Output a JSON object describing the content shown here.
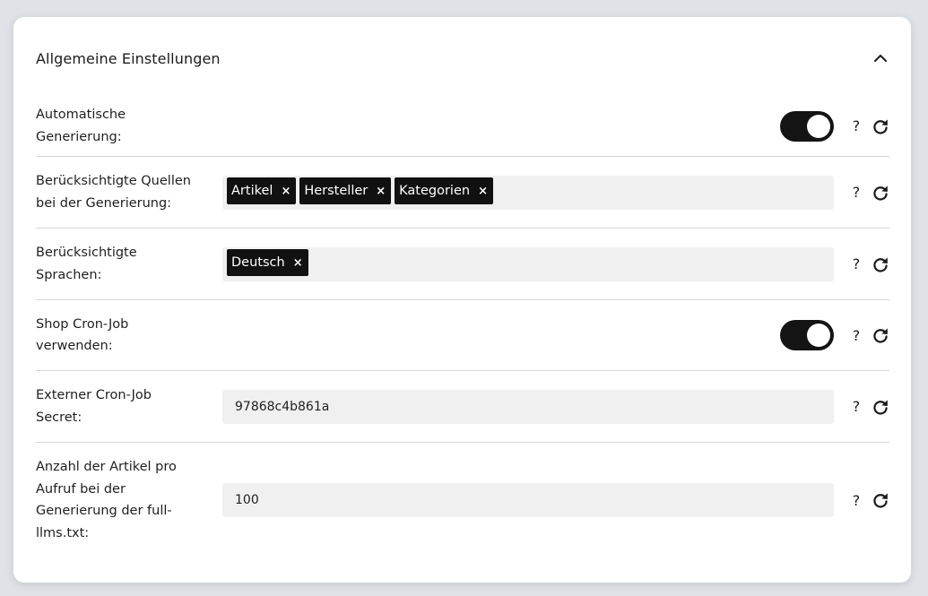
{
  "panel": {
    "title": "Allgemeine Einstellungen",
    "collapse_icon": "chevron-up-icon"
  },
  "settings": [
    {
      "label": "Automatische\nGenerierung:",
      "type": "toggle",
      "enabled": true
    },
    {
      "label": "Berücksichtigte Quellen\nbei der Generierung:",
      "type": "tags",
      "tags": [
        "Artikel",
        "Hersteller",
        "Kategorien"
      ]
    },
    {
      "label": "Berücksichtigte\nSprachen:",
      "type": "tags",
      "tags": [
        "Deutsch"
      ]
    },
    {
      "label": "Shop Cron-Job\nverwenden:",
      "type": "toggle",
      "enabled": true
    },
    {
      "label": "Externer Cron-Job\nSecret:",
      "type": "text",
      "value": "97868c4b861a"
    },
    {
      "label": "Anzahl der Artikel pro\nAufruf bei der\nGenerierung der full-\nllms.txt:",
      "type": "text",
      "value": "100"
    }
  ],
  "actions": {
    "help_label": "?",
    "help_icon": "question-icon",
    "reset_icon": "reset-icon"
  },
  "tag_remove_label": "×"
}
